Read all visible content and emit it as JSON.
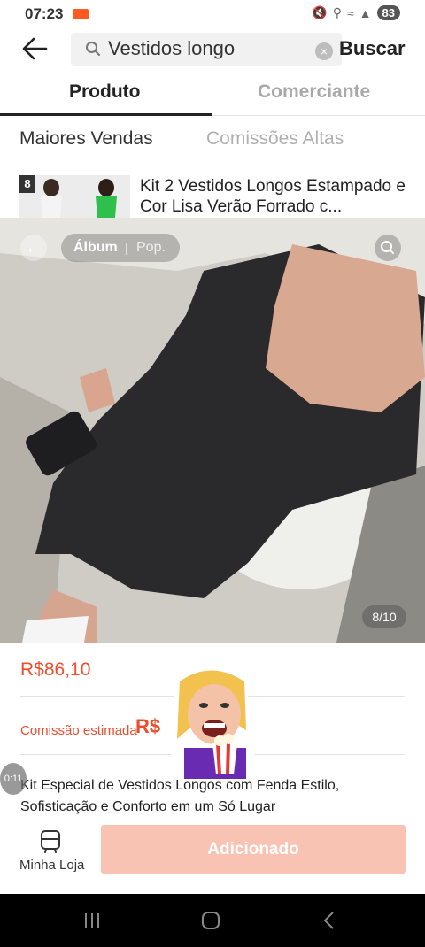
{
  "status_bar": {
    "time": "07:23",
    "battery": "83"
  },
  "header": {
    "search_value": "Vestidos longo",
    "search_button": "Buscar"
  },
  "tabs": [
    {
      "label": "Produto",
      "active": true
    },
    {
      "label": "Comerciante",
      "active": false
    }
  ],
  "sort_options": [
    {
      "label": "Maiores Vendas",
      "active": true
    },
    {
      "label": "Comissões Altas",
      "active": false
    }
  ],
  "product_row": {
    "thumb_badge": "8",
    "title": "Kit 2 Vestidos Longos Estampado e Cor Lisa Verão Forrado c..."
  },
  "viewer": {
    "album_label": "Álbum",
    "pop_label": "Pop.",
    "page_counter": "8/10"
  },
  "details": {
    "price": "R$86,10",
    "commission_label": "Comissão estimada",
    "commission_value": "R$",
    "description": "Kit Especial de Vestidos Longos com Fenda Estilo, Sofisticação e Conforto em um Só Lugar",
    "timer": "0:11"
  },
  "bottom_bar": {
    "store_label": "Minha Loja",
    "add_button": "Adicionado"
  },
  "colors": {
    "accent": "#ee4d2d",
    "button_disabled": "#f8b9a6"
  }
}
